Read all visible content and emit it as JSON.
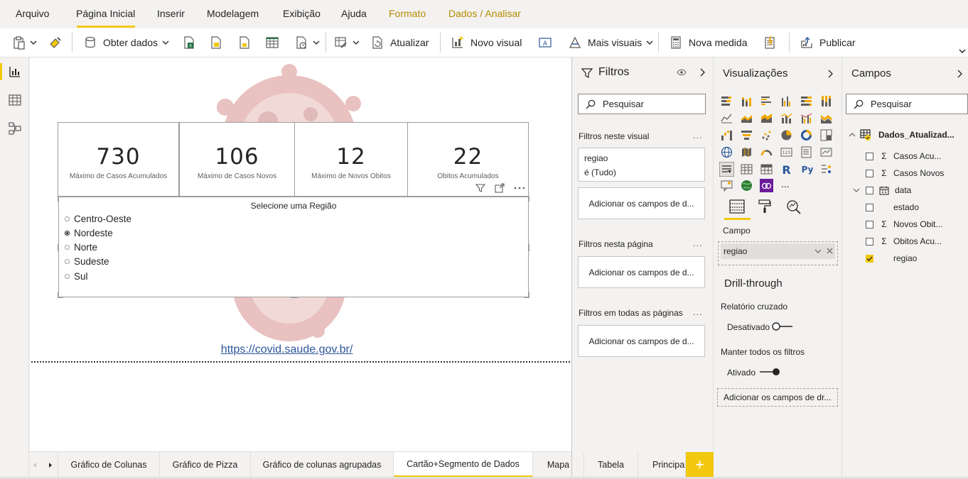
{
  "menu": {
    "items": [
      {
        "label": "Arquivo"
      },
      {
        "label": "Página Inicial"
      },
      {
        "label": "Inserir"
      },
      {
        "label": "Modelagem"
      },
      {
        "label": "Exibição"
      },
      {
        "label": "Ajuda"
      },
      {
        "label": "Formato"
      },
      {
        "label": "Dados / Analisar"
      }
    ]
  },
  "ribbon": {
    "obter_dados": "Obter dados",
    "atualizar": "Atualizar",
    "novo_visual": "Novo visual",
    "mais_visuais": "Mais visuais",
    "nova_medida": "Nova medida",
    "publicar": "Publicar"
  },
  "cards": [
    {
      "value": "730",
      "label": "Máximo de Casos Acumulados"
    },
    {
      "value": "106",
      "label": "Máximo de Casos Novos"
    },
    {
      "value": "12",
      "label": "Máximo de Novos Obitos"
    },
    {
      "value": "22",
      "label": "Obitos Acumulados"
    }
  ],
  "slicer": {
    "title": "Selecione uma Região",
    "items": [
      {
        "label": "Centro-Oeste",
        "selected": false
      },
      {
        "label": "Nordeste",
        "selected": true
      },
      {
        "label": "Norte",
        "selected": false
      },
      {
        "label": "Sudeste",
        "selected": false
      },
      {
        "label": "Sul",
        "selected": false
      }
    ]
  },
  "canvas": {
    "link": "https://covid.saude.gov.br/"
  },
  "filters": {
    "title": "Filtros",
    "search_placeholder": "Pesquisar",
    "visual_section": "Filtros neste visual",
    "field_name": "regiao",
    "field_state": "é (Tudo)",
    "add_fields": "Adicionar os campos de d...",
    "page_section": "Filtros nesta página",
    "all_pages_section": "Filtros em todas as páginas",
    "more": "..."
  },
  "visualizations": {
    "title": "Visualizações",
    "more_visuals": "...",
    "campo_label": "Campo",
    "campo_value": "regiao",
    "drill_title": "Drill-through",
    "relatorio_cruzado": "Relatório cruzado",
    "desativado": "Desativado",
    "manter_filtros": "Manter todos os filtros",
    "ativado": "Ativado",
    "add_drill": "Adicionar os campos de dr..."
  },
  "fields": {
    "title": "Campos",
    "search_placeholder": "Pesquisar",
    "table_name": "Dados_Atualizad...",
    "items": [
      {
        "label": "Casos Acu...",
        "sigma": true,
        "checked": false
      },
      {
        "label": "Casos Novos",
        "sigma": true,
        "checked": false
      },
      {
        "label": "data",
        "sigma": false,
        "checked": false
      },
      {
        "label": "estado",
        "sigma": false,
        "checked": false
      },
      {
        "label": "Novos Obit...",
        "sigma": true,
        "checked": false
      },
      {
        "label": "Obitos Acu...",
        "sigma": true,
        "checked": false
      },
      {
        "label": "regiao",
        "sigma": false,
        "checked": true
      }
    ]
  },
  "tabs": [
    {
      "label": "Gráfico de Colunas",
      "active": false
    },
    {
      "label": "Gráfico de Pizza",
      "active": false
    },
    {
      "label": "Gráfico de colunas agrupadas",
      "active": false
    },
    {
      "label": "Cartão+Segmento de Dados",
      "active": true
    },
    {
      "label": "Mapa",
      "active": false
    },
    {
      "label": "Tabela",
      "active": false
    },
    {
      "label": "Principal",
      "active": false
    }
  ],
  "tab_add": "+",
  "colors": {
    "accent": "#f2c811",
    "link": "#2b579a",
    "gold_menu": "#b68a00"
  }
}
